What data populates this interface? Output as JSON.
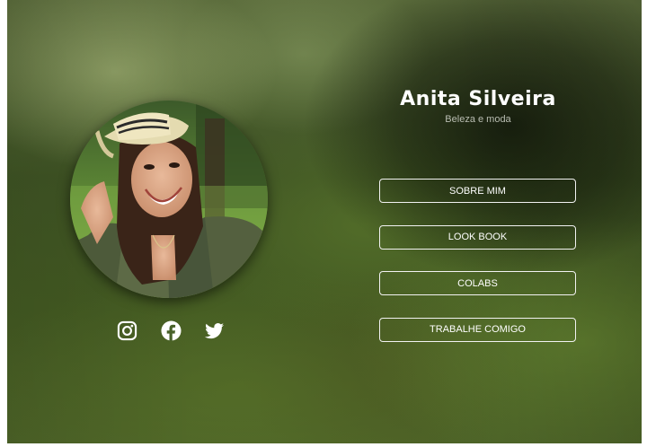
{
  "profile": {
    "name": "Anita Silveira",
    "tagline": "Beleza e moda"
  },
  "menu": {
    "items": [
      {
        "label": "SOBRE MIM"
      },
      {
        "label": "LOOK BOOK"
      },
      {
        "label": "COLABS"
      },
      {
        "label": "TRABALHE COMIGO"
      }
    ]
  },
  "social": {
    "icons": [
      "instagram-icon",
      "facebook-icon",
      "twitter-icon"
    ]
  },
  "colors": {
    "text": "#ffffff",
    "tagline": "#b9bdb2",
    "button_border": "#f2f2f2",
    "background_green": "#435a22"
  }
}
